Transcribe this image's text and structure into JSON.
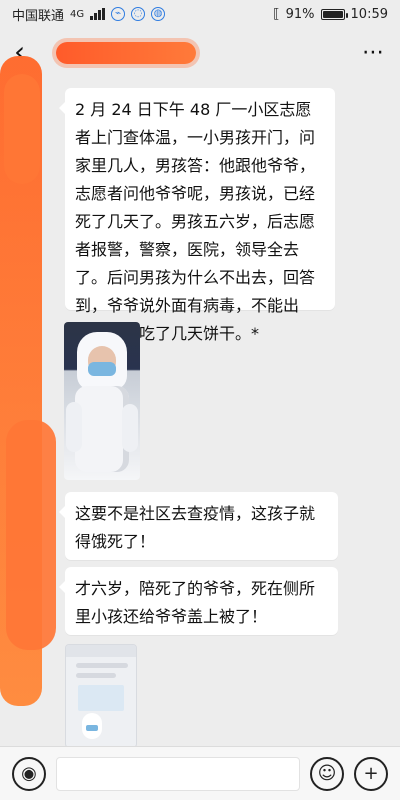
{
  "status": {
    "carrier": "中国联通",
    "network": "4G",
    "battery": "91%",
    "time": "10:59"
  },
  "header": {
    "back_icon": "‹",
    "more_icon": "⋯"
  },
  "messages": [
    {
      "text": "2 月 24 日下午 48 厂一小区志愿者上门查体温，一小男孩开门，问家里几人，男孩答：他跟他爷爷，志愿者问他爷爷呢，男孩说，已经死了几天了。男孩五六岁，后志愿者报警，警察，医院，领导全去了。后问男孩为什么不出去，回答到，爷爷说外面有病毒，不能出去，在家吃了几天饼干。*"
    },
    {
      "text": "这要不是社区去查疫情，这孩子就得饿死了！"
    },
    {
      "text": "才六岁，陪死了的爷爷，死在侧所里小孩还给爷爷盖上被了！"
    }
  ],
  "input": {
    "placeholder": ""
  }
}
